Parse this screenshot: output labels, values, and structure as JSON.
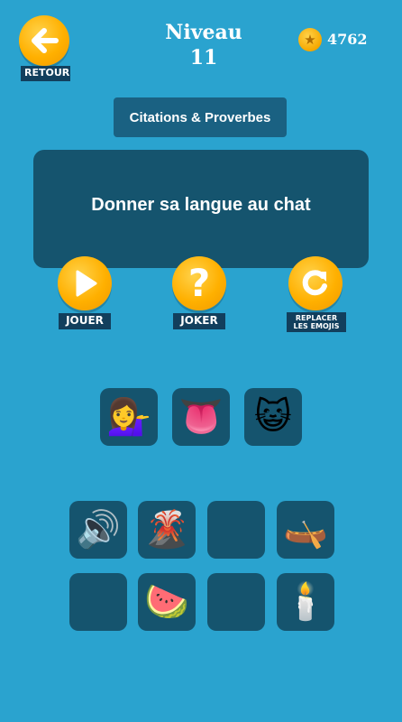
{
  "header": {
    "back_label": "RETOUR",
    "title_line1": "Niveau",
    "title_line2": "11",
    "coins": "4762"
  },
  "category": "Citations & Proverbes",
  "phrase": "Donner sa langue au chat",
  "actions": {
    "play_label": "JOUER",
    "joker_label": "JOKER",
    "replace_label_line1": "REPLACER",
    "replace_label_line2": "LES EMOJIS"
  },
  "answer_slots": [
    {
      "emoji": "💁‍♀️",
      "icon": "woman-tipping-hand-icon"
    },
    {
      "emoji": "👅",
      "icon": "tongue-icon"
    },
    {
      "emoji": "😺",
      "icon": "smiling-cat-icon"
    }
  ],
  "pool": [
    {
      "emoji": "🔊",
      "icon": "speaker-icon"
    },
    {
      "emoji": "🌋",
      "icon": "volcano-icon"
    },
    {
      "emoji": "",
      "icon": ""
    },
    {
      "emoji": "🛶",
      "icon": "canoe-icon"
    },
    {
      "emoji": "",
      "icon": ""
    },
    {
      "emoji": "🍉",
      "icon": "watermelon-icon"
    },
    {
      "emoji": "",
      "icon": ""
    },
    {
      "emoji": "🕯️",
      "icon": "candle-icon"
    }
  ]
}
